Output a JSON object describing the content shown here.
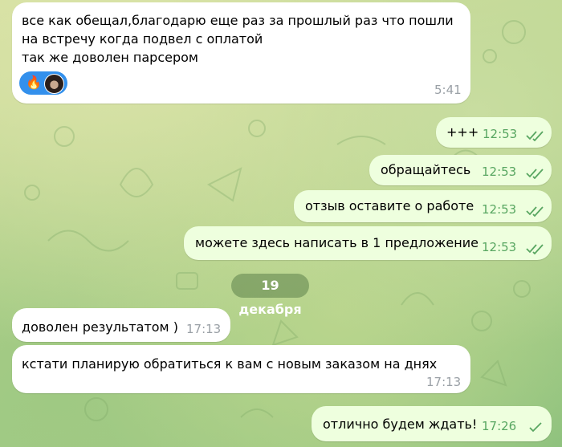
{
  "date_separator": "19 декабря",
  "colors": {
    "incoming": "#ffffff",
    "outgoing": "#eeffde",
    "read_check": "#58a661",
    "reaction_bg": "#3390ec"
  },
  "reactions": {
    "emoji": "fire-emoji",
    "avatar": "user-avatar"
  },
  "messages": [
    {
      "dir": "in",
      "lines": [
        "все как обещал,благодарю еще раз за прошлый раз что пошли",
        "на встречу когда подвел с оплатой",
        "так же доволен парсером"
      ],
      "time": "5:41"
    },
    {
      "dir": "out",
      "text": "+++",
      "time": "12:53"
    },
    {
      "dir": "out",
      "text": "обращайтесь",
      "time": "12:53"
    },
    {
      "dir": "out",
      "text": "отзыв оставите о работе",
      "time": "12:53"
    },
    {
      "dir": "out",
      "text": "можете здесь написать в 1 предложение",
      "time": "12:53"
    },
    {
      "dir": "in",
      "text": "доволен результатом )",
      "time": "17:13"
    },
    {
      "dir": "in",
      "text": "кстати планирую обратиться к вам с новым заказом на днях",
      "time": "17:13"
    },
    {
      "dir": "out",
      "text": "отлично будем ждать!",
      "time": "17:26"
    }
  ]
}
